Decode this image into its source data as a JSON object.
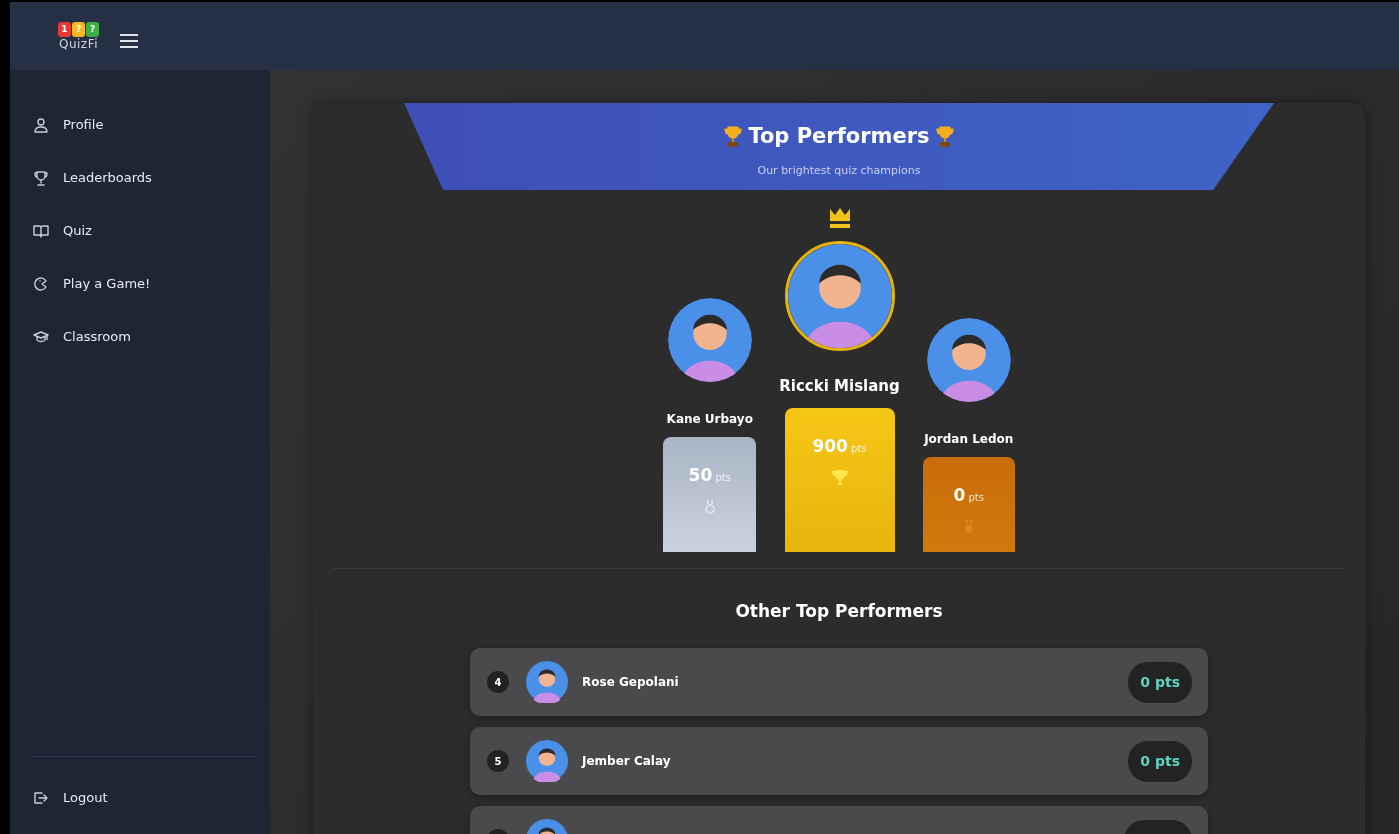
{
  "logo": {
    "marks": [
      {
        "text": "1",
        "color": "#e53935"
      },
      {
        "text": "?",
        "color": "#f6b820"
      },
      {
        "text": "?",
        "color": "#3fae49"
      }
    ],
    "text": "QuizFi"
  },
  "sidebar": {
    "items": [
      {
        "label": "Profile",
        "kind": "profile"
      },
      {
        "label": "Leaderboards",
        "kind": "trophy"
      },
      {
        "label": "Quiz",
        "kind": "book"
      },
      {
        "label": "Play a Game!",
        "kind": "game"
      },
      {
        "label": "Classroom",
        "kind": "classroom"
      }
    ],
    "footer": {
      "label": "Logout",
      "kind": "logout"
    }
  },
  "banner": {
    "title": "Top Performers",
    "subtitle": "Our brightest quiz champions"
  },
  "podium": [
    {
      "kind": "silver",
      "name": "Kane Urbayo",
      "points": "50",
      "unit": "pts"
    },
    {
      "kind": "gold",
      "name": "Riccki Mislang",
      "points": "900",
      "unit": "pts"
    },
    {
      "kind": "bronze",
      "name": "Jordan Ledon",
      "points": "0",
      "unit": "pts"
    }
  ],
  "others": {
    "title": "Other Top Performers",
    "rows": [
      {
        "rank": "4",
        "name": "Rose Gepolani",
        "points": "0 pts"
      },
      {
        "rank": "5",
        "name": "Jember Calay",
        "points": "0 pts"
      },
      {}
    ]
  }
}
